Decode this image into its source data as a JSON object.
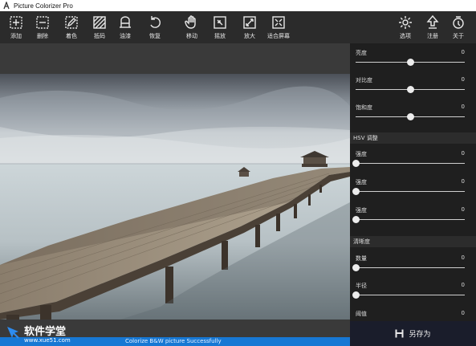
{
  "window": {
    "title": "Picture Colorizer Pro"
  },
  "toolbar": {
    "tools": [
      {
        "label": "添加"
      },
      {
        "label": "删除"
      },
      {
        "label": "着色"
      },
      {
        "label": "抵码"
      },
      {
        "label": "油漆"
      },
      {
        "label": "恢复"
      },
      {
        "label": "移动"
      },
      {
        "label": "摇放"
      },
      {
        "label": "放大"
      },
      {
        "label": "适合屏幕"
      },
      {
        "label": "选项"
      },
      {
        "label": "注册"
      },
      {
        "label": "关于"
      }
    ]
  },
  "panel": {
    "basic": [
      {
        "label": "亮度",
        "value": "0",
        "position": 0.5
      },
      {
        "label": "对比度",
        "value": "0",
        "position": 0.5
      },
      {
        "label": "饱和度",
        "value": "0",
        "position": 0.5
      }
    ],
    "hsv": {
      "title": "HSV 调整",
      "sliders": [
        {
          "label": "强度",
          "value": "0",
          "position": 0
        },
        {
          "label": "强度",
          "value": "0",
          "position": 0
        },
        {
          "label": "强度",
          "value": "0",
          "position": 0
        }
      ]
    },
    "sharpen": {
      "title": "清晰度",
      "sliders": [
        {
          "label": "数量",
          "value": "0",
          "position": 0
        },
        {
          "label": "半径",
          "value": "0",
          "position": 0
        },
        {
          "label": "阈值",
          "value": "0",
          "position": 0
        }
      ]
    }
  },
  "save_button": {
    "label": "另存为"
  },
  "status": {
    "message": "Colorize B&W picture Successfully"
  },
  "watermark": {
    "text": "软件学堂",
    "url": "www.xue51.com"
  },
  "colors": {
    "status_bar": "#1778d4",
    "panel_bg": "#1f1f1f",
    "toolbar_bg": "#2b2b2b",
    "save_bg": "#1a1d2b"
  }
}
